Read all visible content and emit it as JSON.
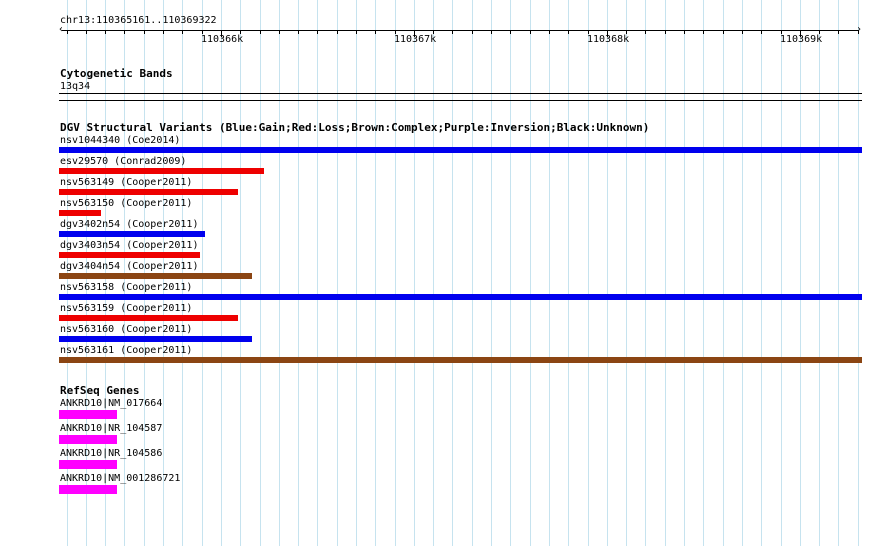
{
  "ruler": {
    "locus": "chr13:110365161..110369322",
    "start": 110365161,
    "end": 110369322,
    "major_labels": [
      "110366k",
      "110367k",
      "110368k",
      "110369k"
    ]
  },
  "tracks": {
    "cytoband": {
      "title": "Cytogenetic Bands",
      "band": "13q34"
    },
    "dgv": {
      "title": "DGV Structural Variants (Blue:Gain;Red:Loss;Brown:Complex;Purple:Inversion;Black:Unknown)",
      "colors": {
        "gain": "#0000ee",
        "loss": "#ee0000",
        "complex": "#8b4513"
      },
      "features": [
        {
          "label": "nsv1044340 (Coe2014)",
          "type": "gain",
          "start": 110365161,
          "end": 110369322
        },
        {
          "label": "esv29570 (Conrad2009)",
          "type": "loss",
          "start": 110365161,
          "end": 110366222
        },
        {
          "label": "nsv563149 (Cooper2011)",
          "type": "loss",
          "start": 110365161,
          "end": 110366090
        },
        {
          "label": "nsv563150 (Cooper2011)",
          "type": "loss",
          "start": 110365161,
          "end": 110365380
        },
        {
          "label": "dgv3402n54 (Cooper2011)",
          "type": "gain",
          "start": 110365161,
          "end": 110365920
        },
        {
          "label": "dgv3403n54 (Cooper2011)",
          "type": "loss",
          "start": 110365161,
          "end": 110365890
        },
        {
          "label": "dgv3404n54 (Cooper2011)",
          "type": "complex",
          "start": 110365161,
          "end": 110366160
        },
        {
          "label": "nsv563158 (Cooper2011)",
          "type": "gain",
          "start": 110365161,
          "end": 110369322
        },
        {
          "label": "nsv563159 (Cooper2011)",
          "type": "loss",
          "start": 110365161,
          "end": 110366090
        },
        {
          "label": "nsv563160 (Cooper2011)",
          "type": "gain",
          "start": 110365161,
          "end": 110366160
        },
        {
          "label": "nsv563161 (Cooper2011)",
          "type": "complex",
          "start": 110365161,
          "end": 110369322
        }
      ]
    },
    "refseq": {
      "title": "RefSeq Genes",
      "color": "#ff00ff",
      "features": [
        {
          "label": "ANKRD10|NM_017664",
          "start": 110365161,
          "end": 110365460
        },
        {
          "label": "ANKRD10|NR_104587",
          "start": 110365161,
          "end": 110365460
        },
        {
          "label": "ANKRD10|NR_104586",
          "start": 110365161,
          "end": 110365460
        },
        {
          "label": "ANKRD10|NM_001286721",
          "start": 110365161,
          "end": 110365460
        }
      ]
    }
  }
}
